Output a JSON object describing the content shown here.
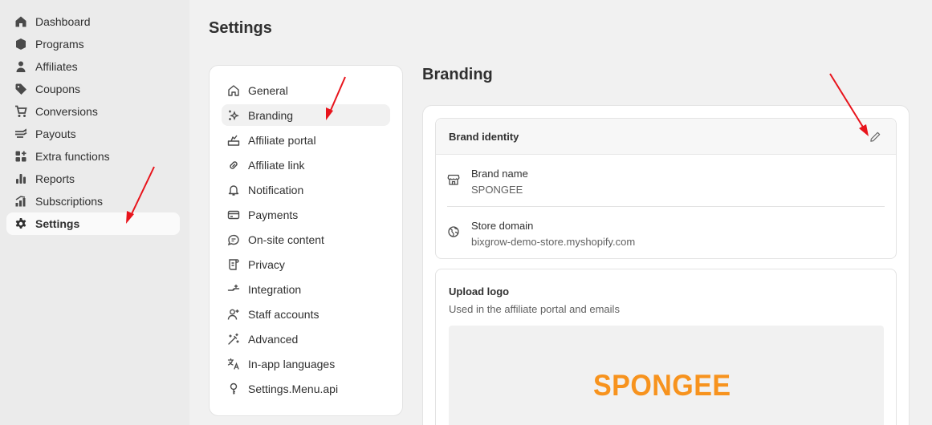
{
  "nav": {
    "items": [
      {
        "label": "Dashboard",
        "icon": "home-icon"
      },
      {
        "label": "Programs",
        "icon": "box-icon"
      },
      {
        "label": "Affiliates",
        "icon": "person-icon"
      },
      {
        "label": "Coupons",
        "icon": "tag-icon"
      },
      {
        "label": "Conversions",
        "icon": "cart-icon"
      },
      {
        "label": "Payouts",
        "icon": "cash-icon"
      },
      {
        "label": "Extra functions",
        "icon": "apps-icon"
      },
      {
        "label": "Reports",
        "icon": "bar-chart-icon"
      },
      {
        "label": "Subscriptions",
        "icon": "subscription-icon"
      },
      {
        "label": "Settings",
        "icon": "gear-icon",
        "active": true
      }
    ]
  },
  "page": {
    "title": "Settings"
  },
  "settings_menu": {
    "items": [
      {
        "label": "General",
        "icon": "home-outline-icon"
      },
      {
        "label": "Branding",
        "icon": "sparkle-icon",
        "active": true
      },
      {
        "label": "Affiliate portal",
        "icon": "portal-icon"
      },
      {
        "label": "Affiliate link",
        "icon": "link-icon"
      },
      {
        "label": "Notification",
        "icon": "bell-icon"
      },
      {
        "label": "Payments",
        "icon": "credit-card-icon"
      },
      {
        "label": "On-site content",
        "icon": "chat-icon"
      },
      {
        "label": "Privacy",
        "icon": "document-icon"
      },
      {
        "label": "Integration",
        "icon": "integration-icon"
      },
      {
        "label": "Staff accounts",
        "icon": "person-add-icon"
      },
      {
        "label": "Advanced",
        "icon": "magic-wand-icon"
      },
      {
        "label": "In-app languages",
        "icon": "language-icon"
      },
      {
        "label": "Settings.Menu.api",
        "icon": "key-icon"
      }
    ]
  },
  "branding": {
    "title": "Branding",
    "identity": {
      "title": "Brand identity",
      "brand_name_label": "Brand name",
      "brand_name_value": "SPONGEE",
      "store_domain_label": "Store domain",
      "store_domain_value": "bixgrow-demo-store.myshopify.com"
    },
    "logo": {
      "title": "Upload logo",
      "subtitle": "Used in the affiliate portal and emails",
      "logo_text": "SPONGEE"
    }
  },
  "colors": {
    "accent_arrow": "#e8141c",
    "logo_orange": "#f7931e"
  }
}
